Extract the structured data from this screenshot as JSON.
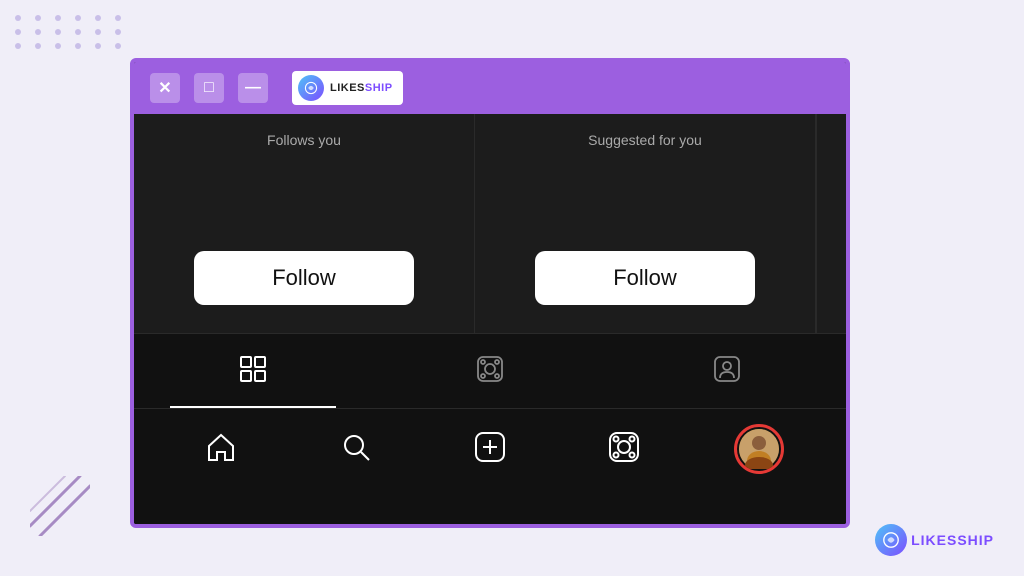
{
  "background_color": "#f0eef8",
  "accent_color": "#9c5fe0",
  "window": {
    "title": "LikesShip",
    "border_color": "#9c5fe0",
    "titlebar": {
      "bg_color": "#9c5fe0",
      "buttons": [
        "✕",
        "□",
        "—"
      ]
    }
  },
  "logo": {
    "text_part1": "LIKES",
    "text_part2": "SHIP"
  },
  "suggestions": [
    {
      "label": "Follows you",
      "button_label": "Follow"
    },
    {
      "label": "Suggested for you",
      "button_label": "Follow"
    },
    {
      "label": "",
      "button_label": ""
    }
  ],
  "profile_tabs": [
    {
      "id": "grid",
      "label": "grid",
      "active": true
    },
    {
      "id": "reels",
      "label": "reels",
      "active": false
    },
    {
      "id": "tagged",
      "label": "tagged",
      "active": false
    }
  ],
  "bottom_nav": [
    {
      "id": "home",
      "label": "home"
    },
    {
      "id": "search",
      "label": "search"
    },
    {
      "id": "add",
      "label": "add"
    },
    {
      "id": "reels",
      "label": "reels"
    },
    {
      "id": "profile",
      "label": "profile"
    }
  ],
  "dots": {
    "rows": 3,
    "cols": 6
  }
}
